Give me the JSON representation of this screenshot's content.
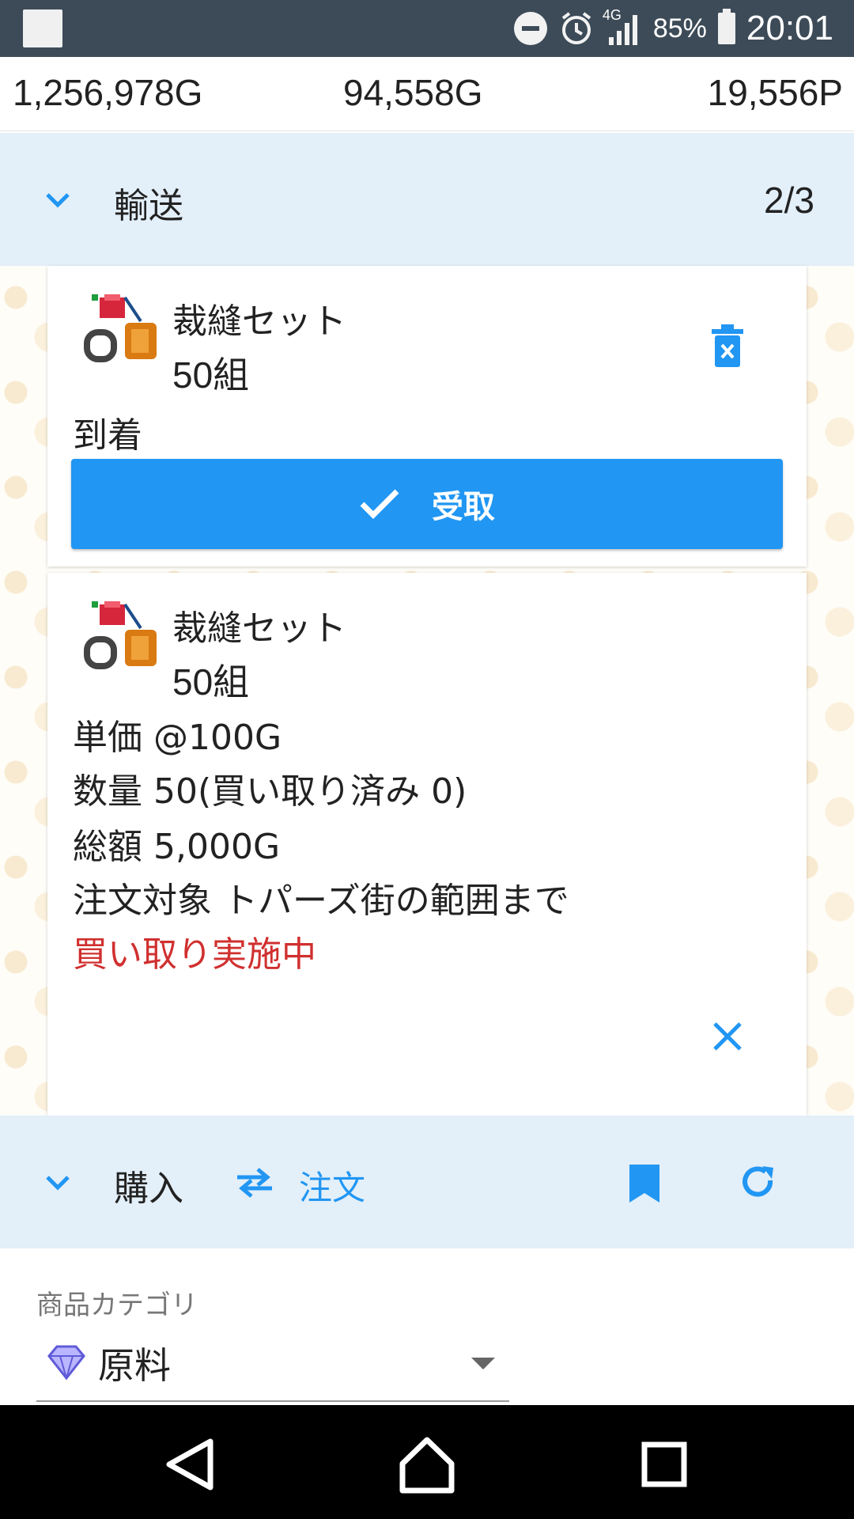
{
  "status_bar": {
    "network": "4G",
    "battery": "85%",
    "time": "20:01"
  },
  "currency": {
    "gold": "1,256,978G",
    "secondary_gold": "94,558G",
    "points": "19,556P"
  },
  "transport": {
    "title": "輸送",
    "count": "2/3"
  },
  "cards": [
    {
      "item_name": "裁縫セット",
      "quantity": "50組",
      "status": "到着",
      "receive_label": "受取"
    },
    {
      "item_name": "裁縫セット",
      "quantity": "50組",
      "unit_price": "単価 @100G",
      "amount": "数量 50(買い取り済み 0)",
      "total": "総額 5,000G",
      "target": "注文対象 トパーズ街の範囲まで",
      "status": "買い取り実施中"
    }
  ],
  "purchase": {
    "title": "購入",
    "order_label": "注文"
  },
  "form": {
    "label": "商品カテゴリ",
    "value": "原料"
  },
  "icons": {
    "accent": "#2196f3",
    "status_red": "#d0302f"
  }
}
